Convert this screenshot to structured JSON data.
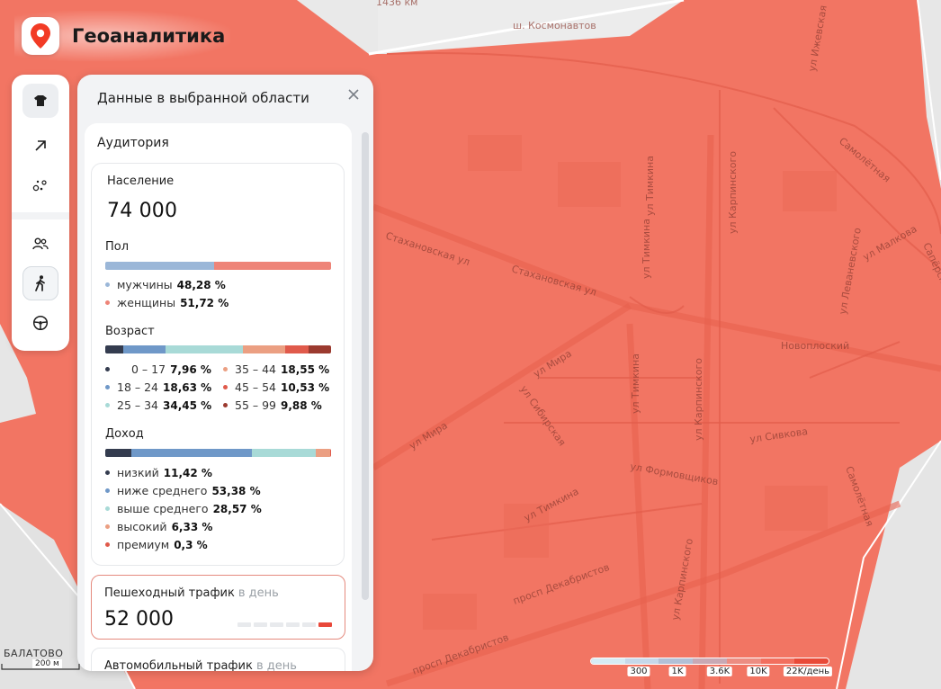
{
  "app": {
    "name": "Геоаналитика"
  },
  "toolbar": {
    "tools": [
      {
        "name": "tshirt-icon"
      },
      {
        "name": "arrow-up-right-icon"
      },
      {
        "name": "dots-icon"
      },
      {
        "name": "people-icon"
      },
      {
        "name": "walking-person-icon"
      },
      {
        "name": "steering-wheel-icon"
      }
    ]
  },
  "panel": {
    "title": "Данные в выбранной области",
    "audience": {
      "title": "Аудитория",
      "population_label": "Население",
      "population_value": "74 000",
      "gender": {
        "title": "Пол",
        "items": [
          {
            "label": "мужчины",
            "value": "48,28 %",
            "color": "#9bb7d8",
            "pct": 48.28
          },
          {
            "label": "женщины",
            "value": "51,72 %",
            "color": "#ee8478",
            "pct": 51.72
          }
        ]
      },
      "age": {
        "title": "Возраст",
        "items": [
          {
            "label": "0 – 17",
            "value": "7,96 %",
            "color": "#343c4f",
            "pct": 7.96
          },
          {
            "label": "18 – 24",
            "value": "18,63 %",
            "color": "#6f98c8",
            "pct": 18.63
          },
          {
            "label": "25 – 34",
            "value": "34,45 %",
            "color": "#a8dad7",
            "pct": 34.45
          },
          {
            "label": "35 – 44",
            "value": "18,55 %",
            "color": "#eb9f82",
            "pct": 18.55
          },
          {
            "label": "45 – 54",
            "value": "10,53 %",
            "color": "#e05a4b",
            "pct": 10.53
          },
          {
            "label": "55 – 99",
            "value": "9,88 %",
            "color": "#9b3a2f",
            "pct": 9.88
          }
        ]
      },
      "income": {
        "title": "Доход",
        "items": [
          {
            "label": "низкий",
            "value": "11,42 %",
            "color": "#343c4f",
            "pct": 11.42
          },
          {
            "label": "ниже среднего",
            "value": "53,38 %",
            "color": "#6f98c8",
            "pct": 53.38
          },
          {
            "label": "выше среднего",
            "value": "28,57 %",
            "color": "#a8dad7",
            "pct": 28.57
          },
          {
            "label": "высокий",
            "value": "6,33 %",
            "color": "#eb9f82",
            "pct": 6.33
          },
          {
            "label": "премиум",
            "value": "0,3 %",
            "color": "#e05a4b",
            "pct": 0.3
          }
        ]
      }
    },
    "pedestrian": {
      "title": "Пешеходный трафик",
      "subtitle": "в день",
      "value": "52 000",
      "level": 6,
      "levels": 6
    },
    "auto": {
      "title": "Автомобильный трафик",
      "subtitle": "в день"
    }
  },
  "map": {
    "streets": [
      "ш. Космонавтов",
      "Стахановская ул",
      "Стахановская ул",
      "ул Мира",
      "ул Мира",
      "ул Тимкина",
      "ул Тимкина",
      "ул Тимкина",
      "ул Тимкина",
      "ул Карпинского",
      "ул Карпинского",
      "ул Карпинского",
      "ул Сивкова",
      "ул Формовщиков",
      "просп Декабристов",
      "просп Декабристов",
      "ул Сибирская",
      "Новоплоский",
      "ул Леваневского",
      "ул Малкова",
      "Самолётная",
      "Сапёрская",
      "Самолётная",
      "ул Ижевская"
    ],
    "km_marker": "1436 км",
    "district": "БАЛАТОВО",
    "scale_label": "200 м",
    "legend": {
      "ticks": [
        "300",
        "1K",
        "3.6K",
        "10K",
        "22K/день"
      ],
      "colors": [
        "#d6ecf5",
        "#c6d8ea",
        "#b2c0d6",
        "#c9a9b4",
        "#ec8d82",
        "#f26f5e",
        "#e94a38"
      ]
    }
  }
}
